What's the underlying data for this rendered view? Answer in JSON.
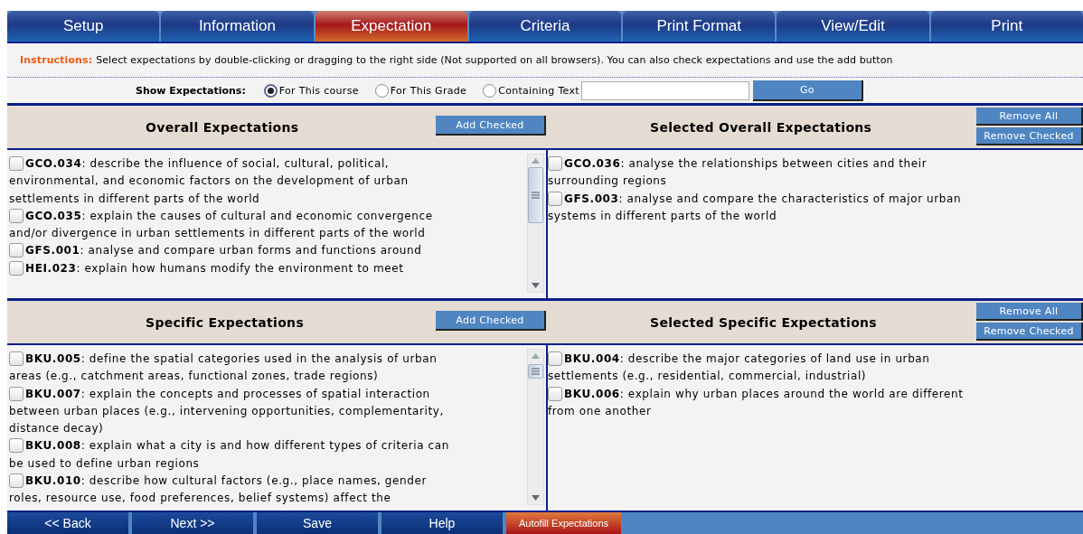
{
  "tabs": [
    {
      "label": "Setup",
      "selected": false
    },
    {
      "label": "Information",
      "selected": false
    },
    {
      "label": "Expectation",
      "selected": true
    },
    {
      "label": "Criteria",
      "selected": false
    },
    {
      "label": "Print Format",
      "selected": false
    },
    {
      "label": "View/Edit",
      "selected": false
    },
    {
      "label": "Print",
      "selected": false
    }
  ],
  "instructions": {
    "label": "Instructions:",
    "text": "Select expectations by double-clicking or dragging to the right side (Not supported on all browsers). You can also check expectations and use the add button"
  },
  "filter": {
    "label": "Show Expectations:",
    "options": [
      {
        "label": "For This course",
        "selected": true
      },
      {
        "label": "For This Grade",
        "selected": false
      },
      {
        "label": "Containing Text",
        "selected": false
      }
    ],
    "go_button": "Go"
  },
  "sections": [
    {
      "title": "Overall Expectations",
      "add_button": "Add Checked",
      "selected_title": "Selected Overall Expectations",
      "remove_all_button": "Remove All",
      "remove_checked_button": "Remove Checked",
      "available": [
        {
          "text": "**GCO.034**: describe the influence of social, cultural, political, environmental, and economic factors on the development of urban settlements in different parts of the world",
          "checked": false
        },
        {
          "text": "**GCO.035**: explain the causes of cultural and economic convergence and/or divergence in urban settlements in different parts of the world",
          "checked": false
        },
        {
          "text": "**GFS.001**: analyse and compare urban forms and functions around",
          "checked": false
        },
        {
          "text": "**HEI.023**: explain how humans modify the environment to meet",
          "checked": false
        }
      ],
      "selected": [
        {
          "text": "**GCO.036**: analyse the relationships between cities and their surrounding regions",
          "checked": false
        },
        {
          "text": "**GFS.003**: analyse and compare the characteristics of major urban systems in different parts of the world",
          "checked": false
        }
      ]
    },
    {
      "title": "Specific Expectations",
      "add_button": "Add Checked",
      "selected_title": "Selected Specific Expectations",
      "remove_all_button": "Remove All",
      "remove_checked_button": "Remove Checked",
      "available": [
        {
          "text": "**BKU.005**: define the spatial categories used in the analysis of urban areas (e.g., catchment areas, functional zones, trade regions)",
          "checked": false
        },
        {
          "text": "**BKU.007**: explain the concepts and processes of spatial interaction between urban places (e.g., intervening opportunities, complementarity, distance decay)",
          "checked": false
        },
        {
          "text": "**BKU.008**: explain what a city is and how different types of criteria can be used to define urban regions",
          "checked": false
        },
        {
          "text": "**BKU.010**: describe how cultural factors (e.g., place names, gender roles, resource use, food preferences, belief systems) affect the",
          "checked": false
        }
      ],
      "selected": [
        {
          "text": "**BKU.004**: describe the major categories of land use in urban settlements (e.g., residential, commercial, industrial)",
          "checked": false
        },
        {
          "text": "**BKU.006**: explain why urban places around the world are different from one another",
          "checked": false
        }
      ]
    }
  ],
  "footer": [
    {
      "label": "<< Back",
      "kind": "nav"
    },
    {
      "label": "Next >>",
      "kind": "nav"
    },
    {
      "label": "Save",
      "kind": "nav"
    },
    {
      "label": "Help",
      "kind": "nav"
    },
    {
      "label": "Autofill Expectations",
      "kind": "accent"
    }
  ]
}
